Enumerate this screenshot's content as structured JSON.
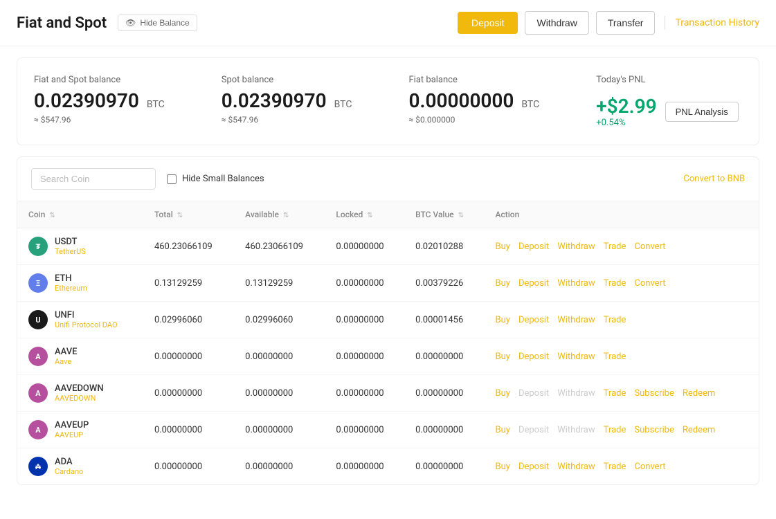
{
  "header": {
    "title": "Fiat and Spot",
    "hide_balance_label": "Hide Balance",
    "deposit_label": "Deposit",
    "withdraw_label": "Withdraw",
    "transfer_label": "Transfer",
    "transaction_history_label": "Transaction History"
  },
  "balances": {
    "fiat_spot": {
      "label": "Fiat and Spot balance",
      "amount": "0.02390970",
      "currency": "BTC",
      "usd": "≈ $547.96"
    },
    "spot": {
      "label": "Spot balance",
      "amount": "0.02390970",
      "currency": "BTC",
      "usd": "≈ $547.96"
    },
    "fiat": {
      "label": "Fiat balance",
      "amount": "0.00000000",
      "currency": "BTC",
      "usd": "≈ $0.000000"
    },
    "pnl": {
      "label": "Today's PNL",
      "value": "+$2.99",
      "percent": "+0.54%",
      "analysis_label": "PNL Analysis"
    }
  },
  "toolbar": {
    "search_placeholder": "Search Coin",
    "hide_small_balances_label": "Hide Small Balances",
    "convert_bnb_label": "Convert to BNB"
  },
  "table": {
    "columns": {
      "coin": "Coin",
      "total": "Total",
      "available": "Available",
      "locked": "Locked",
      "btc_value": "BTC Value",
      "action": "Action"
    },
    "rows": [
      {
        "symbol": "USDT",
        "name": "TetherUS",
        "icon_class": "icon-usdt",
        "icon_text": "₮",
        "total": "460.23066109",
        "available": "460.23066109",
        "locked": "0.00000000",
        "btc_value": "0.02010288",
        "actions": [
          "Buy",
          "Deposit",
          "Withdraw",
          "Trade",
          "Convert"
        ],
        "disabled_actions": []
      },
      {
        "symbol": "ETH",
        "name": "Ethereum",
        "icon_class": "icon-eth",
        "icon_text": "Ξ",
        "total": "0.13129259",
        "available": "0.13129259",
        "locked": "0.00000000",
        "btc_value": "0.00379226",
        "actions": [
          "Buy",
          "Deposit",
          "Withdraw",
          "Trade",
          "Convert"
        ],
        "disabled_actions": []
      },
      {
        "symbol": "UNFI",
        "name": "Unifi Protocol DAO",
        "icon_class": "icon-unfi",
        "icon_text": "U",
        "total": "0.02996060",
        "available": "0.02996060",
        "locked": "0.00000000",
        "btc_value": "0.00001456",
        "actions": [
          "Buy",
          "Deposit",
          "Withdraw",
          "Trade"
        ],
        "disabled_actions": []
      },
      {
        "symbol": "AAVE",
        "name": "Aave",
        "icon_class": "icon-aave",
        "icon_text": "A",
        "total": "0.00000000",
        "available": "0.00000000",
        "locked": "0.00000000",
        "btc_value": "0.00000000",
        "actions": [
          "Buy",
          "Deposit",
          "Withdraw",
          "Trade"
        ],
        "disabled_actions": []
      },
      {
        "symbol": "AAVEDOWN",
        "name": "AAVEDOWN",
        "icon_class": "icon-aavedown",
        "icon_text": "A",
        "total": "0.00000000",
        "available": "0.00000000",
        "locked": "0.00000000",
        "btc_value": "0.00000000",
        "actions": [
          "Buy",
          "Deposit",
          "Withdraw",
          "Trade",
          "Subscribe",
          "Redeem"
        ],
        "disabled_actions": [
          "Deposit",
          "Withdraw"
        ]
      },
      {
        "symbol": "AAVEUP",
        "name": "AAVEUP",
        "icon_class": "icon-aaveup",
        "icon_text": "A",
        "total": "0.00000000",
        "available": "0.00000000",
        "locked": "0.00000000",
        "btc_value": "0.00000000",
        "actions": [
          "Buy",
          "Deposit",
          "Withdraw",
          "Trade",
          "Subscribe",
          "Redeem"
        ],
        "disabled_actions": [
          "Deposit",
          "Withdraw"
        ]
      },
      {
        "symbol": "ADA",
        "name": "Cardano",
        "icon_class": "icon-ada",
        "icon_text": "₳",
        "total": "0.00000000",
        "available": "0.00000000",
        "locked": "0.00000000",
        "btc_value": "0.00000000",
        "actions": [
          "Buy",
          "Deposit",
          "Withdraw",
          "Trade",
          "Convert"
        ],
        "disabled_actions": []
      }
    ]
  }
}
